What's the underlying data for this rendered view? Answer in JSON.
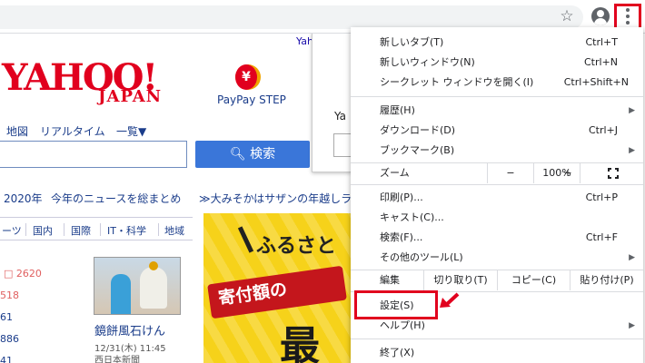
{
  "page": {
    "top_link": "Yah",
    "logo": {
      "main": "YAHOO!",
      "sub": "JAPAN"
    },
    "paypay": {
      "glyph": "¥",
      "label": "PayPay STEP"
    },
    "nav": [
      "地図",
      "リアルタイム",
      "一覧▼"
    ],
    "search_button_label": "検索",
    "news": {
      "year": "2020年",
      "headline": "今年のニュースを総まとめ",
      "promo": "≫大みそかはサザンの年越しラ"
    },
    "tabs": [
      "ーツ",
      "国内",
      "国際",
      "IT・科学",
      "地域"
    ],
    "stats": [
      "2620",
      "518",
      "61",
      "886",
      "41"
    ],
    "article": {
      "title": "鏡餅風石けん",
      "time": "12/31(木) 11:45",
      "source": "西日本新聞"
    },
    "ad": {
      "line1": "ふるさと",
      "ribbon": "寄付額の",
      "big": "最"
    }
  },
  "popup": {
    "text": "Ya"
  },
  "menu": {
    "items": [
      {
        "label": "新しいタブ(T)",
        "shortcut": "Ctrl+T",
        "arrow": ""
      },
      {
        "label": "新しいウィンドウ(N)",
        "shortcut": "Ctrl+N",
        "arrow": ""
      },
      {
        "label": "シークレット ウィンドウを開く(I)",
        "shortcut": "Ctrl+Shift+N",
        "arrow": ""
      },
      {
        "label": "履歴(H)",
        "shortcut": "",
        "arrow": "▶"
      },
      {
        "label": "ダウンロード(D)",
        "shortcut": "Ctrl+J",
        "arrow": ""
      },
      {
        "label": "ブックマーク(B)",
        "shortcut": "",
        "arrow": "▶"
      },
      {
        "label": "印刷(P)...",
        "shortcut": "Ctrl+P",
        "arrow": ""
      },
      {
        "label": "キャスト(C)...",
        "shortcut": "",
        "arrow": ""
      },
      {
        "label": "検索(F)...",
        "shortcut": "Ctrl+F",
        "arrow": ""
      },
      {
        "label": "その他のツール(L)",
        "shortcut": "",
        "arrow": "▶"
      },
      {
        "label": "設定(S)",
        "shortcut": "",
        "arrow": ""
      },
      {
        "label": "ヘルプ(H)",
        "shortcut": "",
        "arrow": "▶"
      },
      {
        "label": "終了(X)",
        "shortcut": "",
        "arrow": ""
      }
    ],
    "zoom": {
      "label": "ズーム",
      "minus": "−",
      "value": "100%",
      "plus": "+"
    },
    "edit": {
      "label": "編集",
      "cut": "切り取り(T)",
      "copy": "コピー(C)",
      "paste": "貼り付け(P)"
    }
  },
  "colors": {
    "highlight": "#e1001e",
    "yahoo_red": "#e1001e",
    "search_blue": "#3a76d9"
  }
}
